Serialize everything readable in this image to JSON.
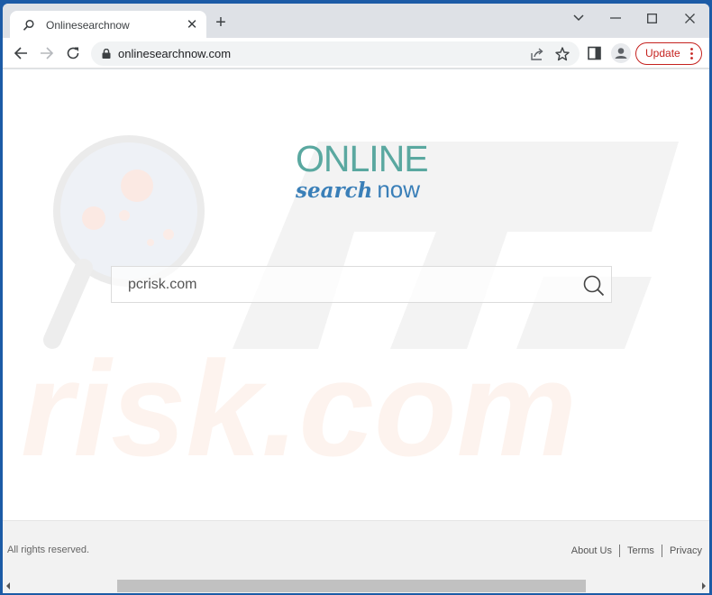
{
  "browser": {
    "tab": {
      "title": "Onlinesearchnow",
      "icon": "search-icon",
      "close_label": "✕"
    },
    "new_tab_label": "+",
    "window_controls": {
      "dropdown": "⌄",
      "minimize": "–",
      "maximize": "☐",
      "close": "✕"
    },
    "toolbar": {
      "back_icon": "arrow-left-icon",
      "forward_icon": "arrow-right-icon",
      "reload_icon": "reload-icon",
      "url": "onlinesearchnow.com",
      "update_label": "Update"
    }
  },
  "page": {
    "logo": {
      "line1": "ONLINE",
      "line2_script": "search",
      "line2_plain": "now"
    },
    "search": {
      "value": "pcrisk.com",
      "placeholder": ""
    },
    "footer": {
      "copyright": "All rights reserved.",
      "links": [
        {
          "label": "About Us"
        },
        {
          "label": "Terms"
        },
        {
          "label": "Privacy"
        }
      ]
    },
    "watermark": {
      "text_top": "PC",
      "text_bottom": "risk.com"
    }
  },
  "colors": {
    "logo_teal": "#5aa8a0",
    "logo_blue": "#3a7fb8",
    "update_red": "#c5221f",
    "frame_blue": "#1c5ba6"
  }
}
